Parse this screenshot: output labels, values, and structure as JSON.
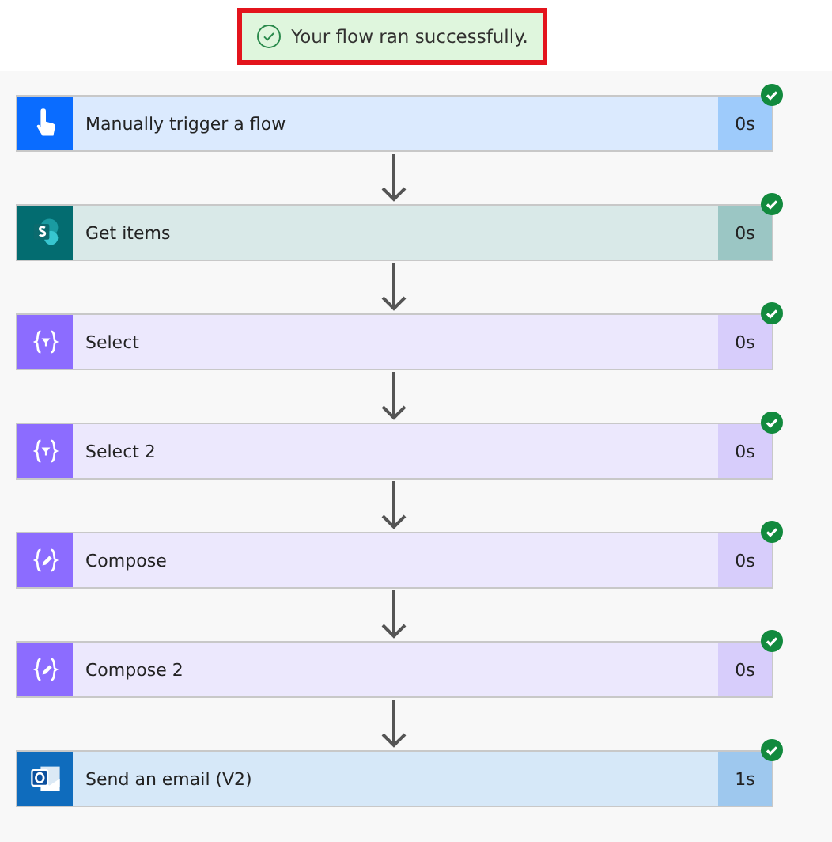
{
  "banner": {
    "message": "Your flow ran successfully.",
    "highlighted": true
  },
  "steps": [
    {
      "kind": "trigger",
      "title": "Manually trigger a flow",
      "duration": "0s",
      "succeeded": true
    },
    {
      "kind": "sharepoint",
      "title": "Get items",
      "duration": "0s",
      "succeeded": true
    },
    {
      "kind": "select",
      "title": "Select",
      "duration": "0s",
      "succeeded": true
    },
    {
      "kind": "select",
      "title": "Select 2",
      "duration": "0s",
      "succeeded": true
    },
    {
      "kind": "compose",
      "title": "Compose",
      "duration": "0s",
      "succeeded": true
    },
    {
      "kind": "compose",
      "title": "Compose 2",
      "duration": "0s",
      "succeeded": true
    },
    {
      "kind": "outlook",
      "title": "Send an email (V2)",
      "duration": "1s",
      "succeeded": true
    }
  ]
}
